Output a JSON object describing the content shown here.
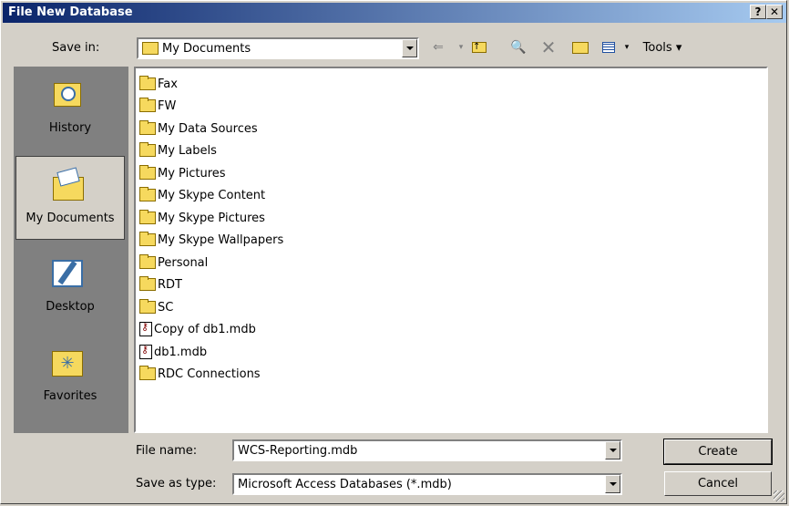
{
  "window": {
    "title": "File New Database",
    "help_glyph": "?",
    "close_glyph": "✕"
  },
  "toolbar": {
    "save_in_label": "Save in:",
    "save_in_value": "My Documents",
    "tools_label": "Tools ▾",
    "icons": [
      "back-icon",
      "up-folder-icon",
      "search-web-icon",
      "delete-icon",
      "new-folder-icon",
      "views-icon",
      "tools-menu"
    ]
  },
  "places": [
    {
      "label": "History",
      "icon": "history-icon"
    },
    {
      "label": "My Documents",
      "icon": "my-documents-icon",
      "active": true
    },
    {
      "label": "Desktop",
      "icon": "desktop-icon"
    },
    {
      "label": "Favorites",
      "icon": "favorites-icon"
    }
  ],
  "files": [
    {
      "name": "Fax",
      "type": "folder"
    },
    {
      "name": "FW",
      "type": "folder"
    },
    {
      "name": "My Data Sources",
      "type": "folder"
    },
    {
      "name": "My Labels",
      "type": "folder"
    },
    {
      "name": "My Pictures",
      "type": "folder"
    },
    {
      "name": "My Skype Content",
      "type": "folder"
    },
    {
      "name": "My Skype Pictures",
      "type": "folder"
    },
    {
      "name": "My Skype Wallpapers",
      "type": "folder"
    },
    {
      "name": "Personal",
      "type": "folder"
    },
    {
      "name": "RDT",
      "type": "folder"
    },
    {
      "name": "SC",
      "type": "folder"
    },
    {
      "name": "Copy of db1.mdb",
      "type": "mdb"
    },
    {
      "name": "db1.mdb",
      "type": "mdb"
    },
    {
      "name": "RDC Connections",
      "type": "folder"
    }
  ],
  "form": {
    "file_name_label": "File name:",
    "file_name_value": "WCS-Reporting.mdb",
    "save_as_type_label": "Save as type:",
    "save_as_type_value": "Microsoft Access Databases (*.mdb)"
  },
  "buttons": {
    "create": "Create",
    "cancel": "Cancel"
  }
}
